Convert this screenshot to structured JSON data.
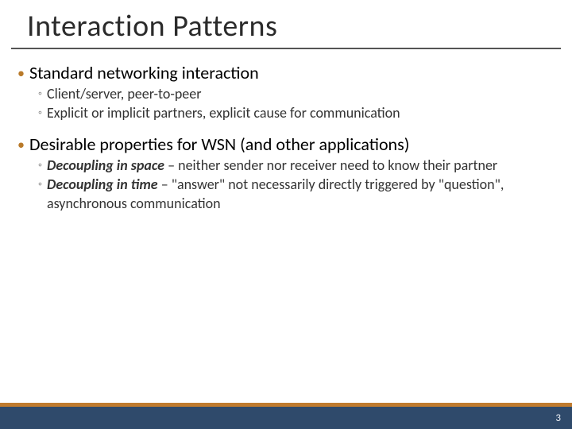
{
  "title": "Interaction Patterns",
  "items": [
    {
      "text": "Standard networking interaction",
      "children": [
        {
          "text": "Client/server, peer-to-peer"
        },
        {
          "text": "Explicit or implicit partners, explicit cause for communication"
        }
      ]
    },
    {
      "text": "Desirable properties for WSN (and other applications)",
      "children": [
        {
          "bold": "Decoupling in space",
          "rest": " – neither sender nor receiver need to know their partner"
        },
        {
          "bold": "Decoupling in time",
          "rest": " – \"answer\" not necessarily directly triggered by \"question\", asynchronous communication"
        }
      ]
    }
  ],
  "page_number": "3"
}
